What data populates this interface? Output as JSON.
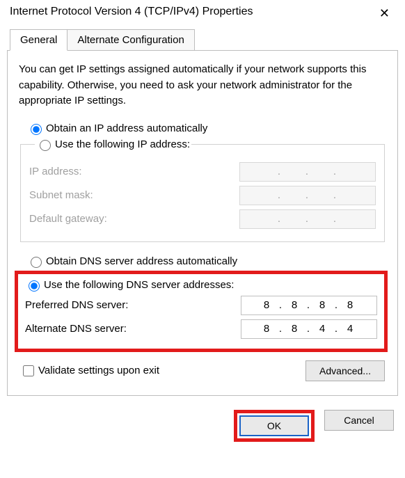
{
  "window": {
    "title": "Internet Protocol Version 4 (TCP/IPv4) Properties",
    "close_glyph": "✕"
  },
  "tabs": {
    "general": "General",
    "alternate": "Alternate Configuration"
  },
  "intro": "You can get IP settings assigned automatically if your network supports this capability. Otherwise, you need to ask your network administrator for the appropriate IP settings.",
  "ip_section": {
    "obtain_auto": "Obtain an IP address automatically",
    "use_following": "Use the following IP address:",
    "ip_address_label": "IP address:",
    "subnet_label": "Subnet mask:",
    "gateway_label": "Default gateway:",
    "ip_address_value": [
      "",
      "",
      "",
      ""
    ],
    "subnet_value": [
      "",
      "",
      "",
      ""
    ],
    "gateway_value": [
      "",
      "",
      "",
      ""
    ]
  },
  "dns_section": {
    "obtain_auto": "Obtain DNS server address automatically",
    "use_following": "Use the following DNS server addresses:",
    "preferred_label": "Preferred DNS server:",
    "alternate_label": "Alternate DNS server:",
    "preferred_value": [
      "8",
      "8",
      "8",
      "8"
    ],
    "alternate_value": [
      "8",
      "8",
      "4",
      "4"
    ]
  },
  "validate_label": "Validate settings upon exit",
  "buttons": {
    "advanced": "Advanced...",
    "ok": "OK",
    "cancel": "Cancel"
  }
}
